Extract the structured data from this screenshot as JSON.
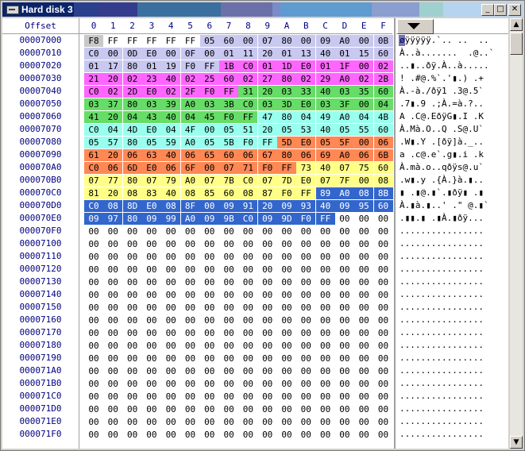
{
  "window": {
    "title": "Hard disk 3",
    "minimize": "_",
    "maximize": "□",
    "close": "✕"
  },
  "header": {
    "offset_label": "Offset",
    "columns": [
      "0",
      "1",
      "2",
      "3",
      "4",
      "5",
      "6",
      "7",
      "8",
      "9",
      "A",
      "B",
      "C",
      "D",
      "E",
      "F"
    ]
  },
  "colors": {
    "bg": "#ffffff",
    "offset_text": "#000080",
    "selected": "#000080"
  },
  "rows": [
    {
      "offset": "00007000",
      "bytes": [
        "F8",
        "FF",
        "FF",
        "FF",
        "FF",
        "FF",
        "05",
        "60",
        "00",
        "07",
        "80",
        "00",
        "09",
        "A0",
        "00",
        "0B"
      ],
      "ascii": "øÿÿÿÿÿ.`.. ..  ..",
      "colors": [
        "#c8c8c8",
        "",
        "",
        "",
        "",
        "",
        "#c8c8f0",
        "#c8c8f0",
        "#c8c8f0",
        "#c8c8f0",
        "#c8c8f0",
        "#c8c8f0",
        "#c8c8f0",
        "#c8c8f0",
        "#c8c8f0",
        "#c8c8f0"
      ]
    },
    {
      "offset": "00007010",
      "bytes": [
        "C0",
        "00",
        "0D",
        "E0",
        "00",
        "0F",
        "00",
        "01",
        "11",
        "20",
        "01",
        "13",
        "40",
        "01",
        "15",
        "60"
      ],
      "ascii": "À..à.......  .@..`",
      "colors": [
        "#c8c8f0",
        "#c8c8f0",
        "#c8c8f0",
        "#c8c8f0",
        "#c8c8f0",
        "#c8c8f0",
        "#c8c8f0",
        "#c8c8f0",
        "#c8c8f0",
        "#c8c8f0",
        "#c8c8f0",
        "#c8c8f0",
        "#c8c8f0",
        "#c8c8f0",
        "#c8c8f0",
        "#c8c8f0"
      ]
    },
    {
      "offset": "00007020",
      "bytes": [
        "01",
        "17",
        "80",
        "01",
        "19",
        "F0",
        "FF",
        "1B",
        "C0",
        "01",
        "1D",
        "E0",
        "01",
        "1F",
        "00",
        "02"
      ],
      "ascii": "..▮..ðÿ.À..à.....",
      "colors": [
        "#c8c8f0",
        "#c8c8f0",
        "#c8c8f0",
        "#c8c8f0",
        "#c8c8f0",
        "#c8c8f0",
        "#c8c8f0",
        "#ff66ff",
        "#ff66ff",
        "#ff66ff",
        "#ff66ff",
        "#ff66ff",
        "#ff66ff",
        "#ff66ff",
        "#ff66ff",
        "#ff66ff"
      ]
    },
    {
      "offset": "00007030",
      "bytes": [
        "21",
        "20",
        "02",
        "23",
        "40",
        "02",
        "25",
        "60",
        "02",
        "27",
        "80",
        "02",
        "29",
        "A0",
        "02",
        "2B"
      ],
      "ascii": "! .#@.%`.'▮.) .+",
      "colors": [
        "#ff66ff",
        "#ff66ff",
        "#ff66ff",
        "#ff66ff",
        "#ff66ff",
        "#ff66ff",
        "#ff66ff",
        "#ff66ff",
        "#ff66ff",
        "#ff66ff",
        "#ff66ff",
        "#ff66ff",
        "#ff66ff",
        "#ff66ff",
        "#ff66ff",
        "#ff66ff"
      ]
    },
    {
      "offset": "00007040",
      "bytes": [
        "C0",
        "02",
        "2D",
        "E0",
        "02",
        "2F",
        "F0",
        "FF",
        "31",
        "20",
        "03",
        "33",
        "40",
        "03",
        "35",
        "60"
      ],
      "ascii": "À.-à./ðÿ1 .3@.5`",
      "colors": [
        "#ff66ff",
        "#ff66ff",
        "#ff66ff",
        "#ff66ff",
        "#ff66ff",
        "#ff66ff",
        "#ff66ff",
        "#ff66ff",
        "#66dd66",
        "#66dd66",
        "#66dd66",
        "#66dd66",
        "#66dd66",
        "#66dd66",
        "#66dd66",
        "#66dd66"
      ]
    },
    {
      "offset": "00007050",
      "bytes": [
        "03",
        "37",
        "80",
        "03",
        "39",
        "A0",
        "03",
        "3B",
        "C0",
        "03",
        "3D",
        "E0",
        "03",
        "3F",
        "00",
        "04"
      ],
      "ascii": ".7▮.9 .;À.=à.?..",
      "colors": [
        "#66dd66",
        "#66dd66",
        "#66dd66",
        "#66dd66",
        "#66dd66",
        "#66dd66",
        "#66dd66",
        "#66dd66",
        "#66dd66",
        "#66dd66",
        "#66dd66",
        "#66dd66",
        "#66dd66",
        "#66dd66",
        "#66dd66",
        "#66dd66"
      ]
    },
    {
      "offset": "00007060",
      "bytes": [
        "41",
        "20",
        "04",
        "43",
        "40",
        "04",
        "45",
        "F0",
        "FF",
        "47",
        "80",
        "04",
        "49",
        "A0",
        "04",
        "4B"
      ],
      "ascii": "A .C@.EðÿG▮.I .K",
      "colors": [
        "#66dd66",
        "#66dd66",
        "#66dd66",
        "#66dd66",
        "#66dd66",
        "#66dd66",
        "#66dd66",
        "#66dd66",
        "#66dd66",
        "#99ffee",
        "#99ffee",
        "#99ffee",
        "#99ffee",
        "#99ffee",
        "#99ffee",
        "#99ffee"
      ]
    },
    {
      "offset": "00007070",
      "bytes": [
        "C0",
        "04",
        "4D",
        "E0",
        "04",
        "4F",
        "00",
        "05",
        "51",
        "20",
        "05",
        "53",
        "40",
        "05",
        "55",
        "60"
      ],
      "ascii": "À.Mà.O..Q .S@.U`",
      "colors": [
        "#99ffee",
        "#99ffee",
        "#99ffee",
        "#99ffee",
        "#99ffee",
        "#99ffee",
        "#99ffee",
        "#99ffee",
        "#99ffee",
        "#99ffee",
        "#99ffee",
        "#99ffee",
        "#99ffee",
        "#99ffee",
        "#99ffee",
        "#99ffee"
      ]
    },
    {
      "offset": "00007080",
      "bytes": [
        "05",
        "57",
        "80",
        "05",
        "59",
        "A0",
        "05",
        "5B",
        "F0",
        "FF",
        "5D",
        "E0",
        "05",
        "5F",
        "00",
        "06"
      ],
      "ascii": ".W▮.Y .[ðÿ]à._..",
      "colors": [
        "#99ffee",
        "#99ffee",
        "#99ffee",
        "#99ffee",
        "#99ffee",
        "#99ffee",
        "#99ffee",
        "#99ffee",
        "#99ffee",
        "#99ffee",
        "#ff8855",
        "#ff8855",
        "#ff8855",
        "#ff8855",
        "#ff8855",
        "#ff8855"
      ]
    },
    {
      "offset": "00007090",
      "bytes": [
        "61",
        "20",
        "06",
        "63",
        "40",
        "06",
        "65",
        "60",
        "06",
        "67",
        "80",
        "06",
        "69",
        "A0",
        "06",
        "6B"
      ],
      "ascii": "a .c@.e`.g▮.i .k",
      "colors": [
        "#ff8855",
        "#ff8855",
        "#ff8855",
        "#ff8855",
        "#ff8855",
        "#ff8855",
        "#ff8855",
        "#ff8855",
        "#ff8855",
        "#ff8855",
        "#ff8855",
        "#ff8855",
        "#ff8855",
        "#ff8855",
        "#ff8855",
        "#ff8855"
      ]
    },
    {
      "offset": "000070A0",
      "bytes": [
        "C0",
        "06",
        "6D",
        "E0",
        "06",
        "6F",
        "00",
        "07",
        "71",
        "F0",
        "FF",
        "73",
        "40",
        "07",
        "75",
        "60"
      ],
      "ascii": "À.mà.o..qðÿs@.u`",
      "colors": [
        "#ff8855",
        "#ff8855",
        "#ff8855",
        "#ff8855",
        "#ff8855",
        "#ff8855",
        "#ff8855",
        "#ff8855",
        "#ff8855",
        "#ff8855",
        "#ff8855",
        "#ffff88",
        "#ffff88",
        "#ffff88",
        "#ffff88",
        "#ffff88"
      ]
    },
    {
      "offset": "000070B0",
      "bytes": [
        "07",
        "77",
        "80",
        "07",
        "79",
        "A0",
        "07",
        "7B",
        "C0",
        "07",
        "7D",
        "E0",
        "07",
        "7F",
        "00",
        "08"
      ],
      "ascii": ".w▮.y .{À.}à.▮..",
      "colors": [
        "#ffff88",
        "#ffff88",
        "#ffff88",
        "#ffff88",
        "#ffff88",
        "#ffff88",
        "#ffff88",
        "#ffff88",
        "#ffff88",
        "#ffff88",
        "#ffff88",
        "#ffff88",
        "#ffff88",
        "#ffff88",
        "#ffff88",
        "#ffff88"
      ]
    },
    {
      "offset": "000070C0",
      "bytes": [
        "81",
        "20",
        "08",
        "83",
        "40",
        "08",
        "85",
        "60",
        "08",
        "87",
        "F0",
        "FF",
        "89",
        "A0",
        "08",
        "8B"
      ],
      "ascii": "▮ .▮@.▮`.▮ðÿ▮ .▮",
      "colors": [
        "#ffff88",
        "#ffff88",
        "#ffff88",
        "#ffff88",
        "#ffff88",
        "#ffff88",
        "#ffff88",
        "#ffff88",
        "#ffff88",
        "#ffff88",
        "#ffff88",
        "#ffff88",
        "#3366cc",
        "#3366cc",
        "#3366cc",
        "#3366cc"
      ]
    },
    {
      "offset": "000070D0",
      "bytes": [
        "C0",
        "08",
        "8D",
        "E0",
        "08",
        "8F",
        "00",
        "09",
        "91",
        "20",
        "09",
        "93",
        "40",
        "09",
        "95",
        "60"
      ],
      "ascii": "À.▮à.▮..' .\" @.▮`",
      "colors": [
        "#3366cc",
        "#3366cc",
        "#3366cc",
        "#3366cc",
        "#3366cc",
        "#3366cc",
        "#3366cc",
        "#3366cc",
        "#3366cc",
        "#3366cc",
        "#3366cc",
        "#3366cc",
        "#3366cc",
        "#3366cc",
        "#3366cc",
        "#3366cc"
      ]
    },
    {
      "offset": "000070E0",
      "bytes": [
        "09",
        "97",
        "80",
        "09",
        "99",
        "A0",
        "09",
        "9B",
        "C0",
        "09",
        "9D",
        "F0",
        "FF",
        "00",
        "00",
        "00"
      ],
      "ascii": ".▮▮.▮ .▮À.▮ðÿ...",
      "colors": [
        "#3366cc",
        "#3366cc",
        "#3366cc",
        "#3366cc",
        "#3366cc",
        "#3366cc",
        "#3366cc",
        "#3366cc",
        "#3366cc",
        "#3366cc",
        "#3366cc",
        "#3366cc",
        "#3366cc",
        "",
        "",
        ""
      ]
    }
  ],
  "zero_rows": [
    "000070F0",
    "00007100",
    "00007110",
    "00007120",
    "00007130",
    "00007140",
    "00007150",
    "00007160",
    "00007170",
    "00007180",
    "00007190",
    "000071A0",
    "000071B0",
    "000071C0",
    "000071D0",
    "000071E0",
    "000071F0"
  ],
  "zero_byte": "00",
  "zero_ascii": "................",
  "scroll": {
    "up": "▲",
    "down": "▼"
  }
}
